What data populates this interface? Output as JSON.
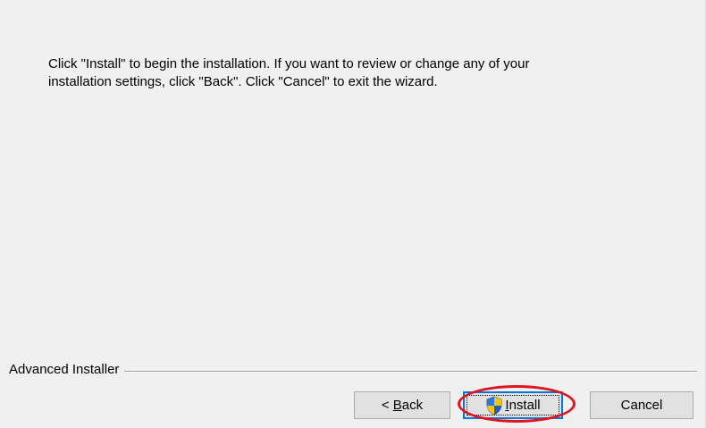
{
  "message": {
    "line1": "Click \"Install\" to begin the installation.  If you want to review or change any of your",
    "line2": "installation settings, click \"Back\".  Click \"Cancel\" to exit the wizard."
  },
  "branding": {
    "label": "Advanced Installer"
  },
  "buttons": {
    "back_prefix": "< ",
    "back_mnemonic": "B",
    "back_rest": "ack",
    "install_mnemonic": "I",
    "install_rest": "nstall",
    "cancel": "Cancel"
  },
  "colors": {
    "dialog_background": "#f0f0f0",
    "focus_border": "#0078d7",
    "annotation_ellipse": "#e0141c"
  },
  "icons": {
    "install_button_icon": "uac-shield-icon"
  }
}
